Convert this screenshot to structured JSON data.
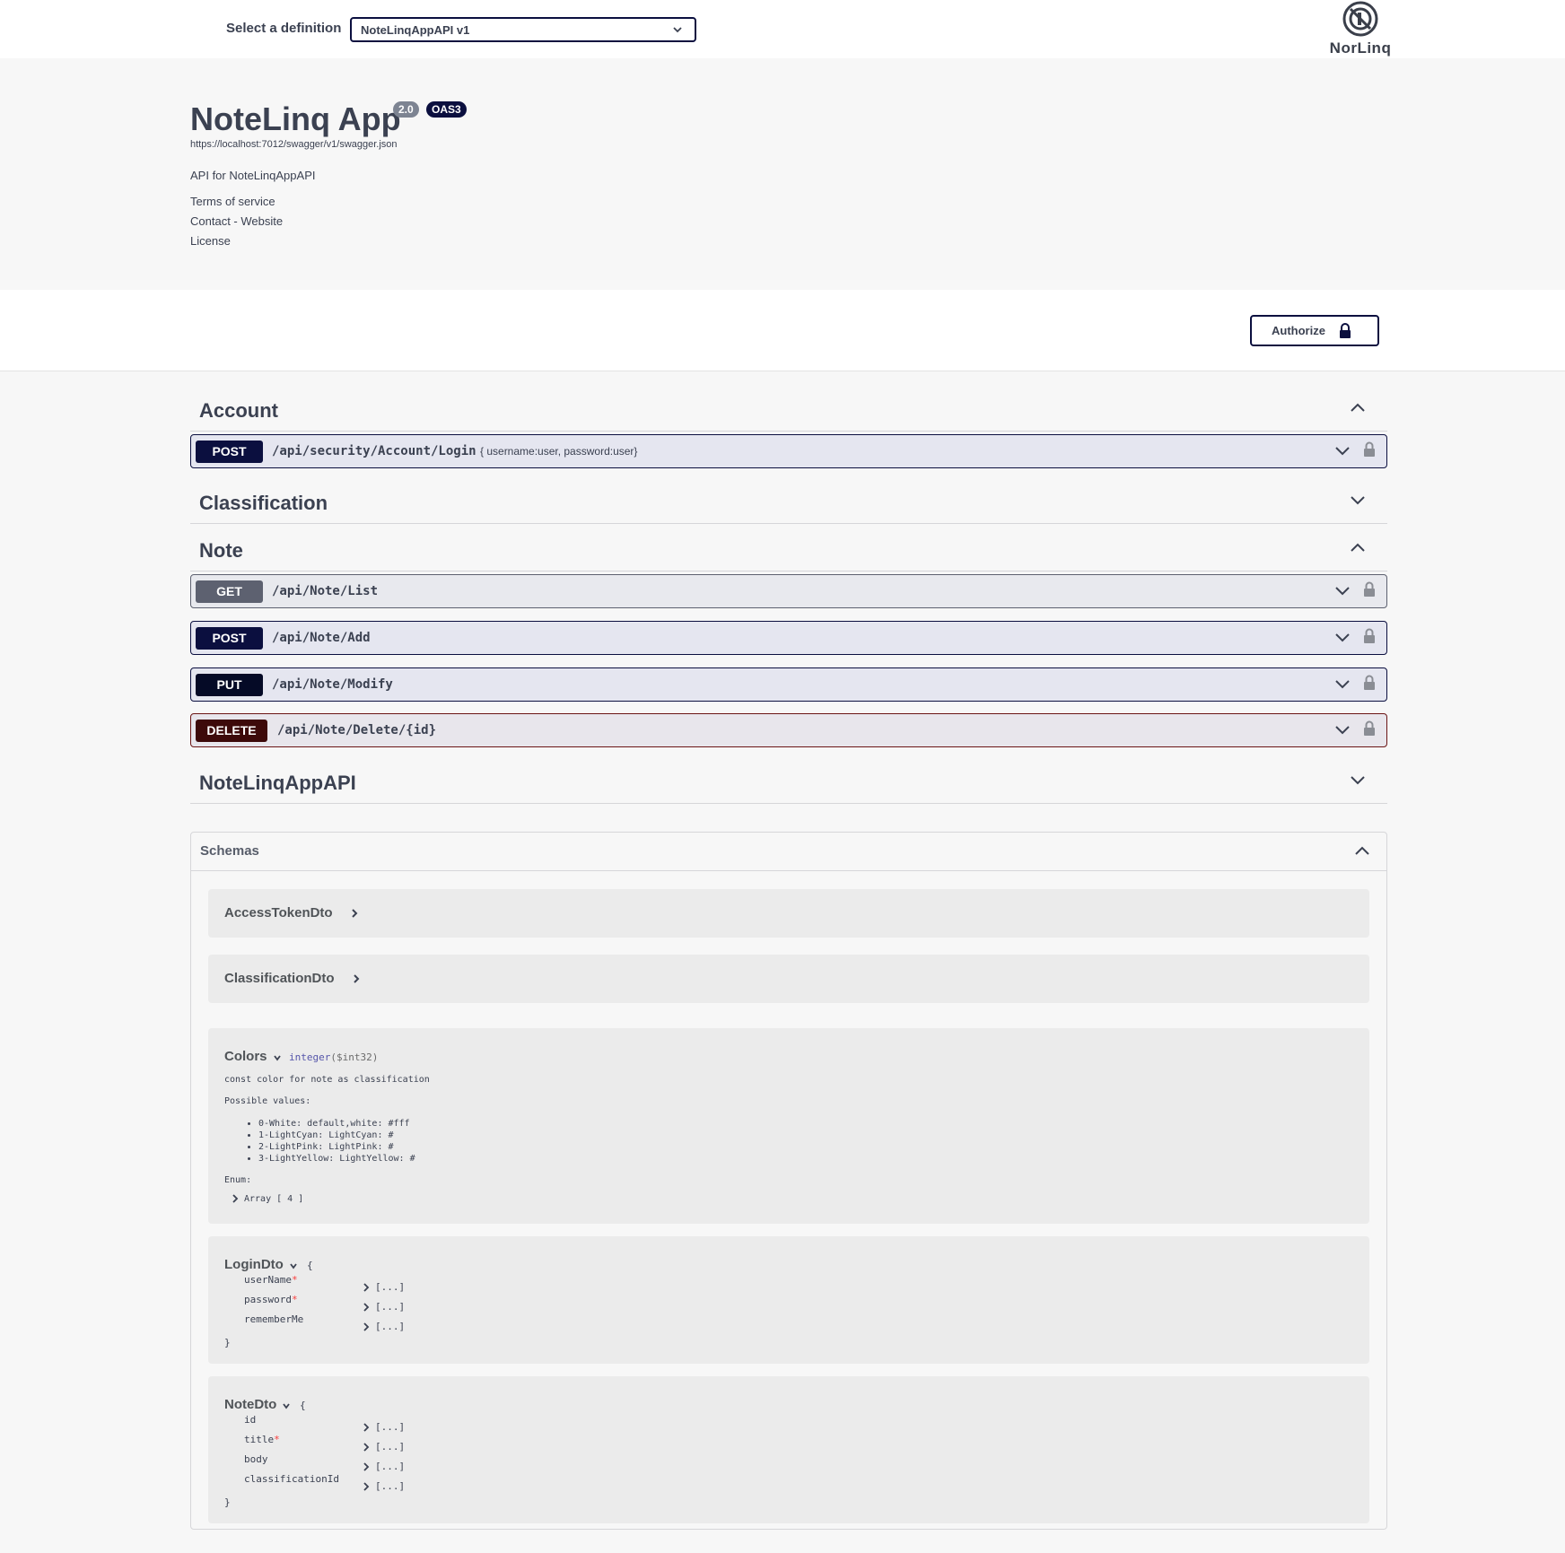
{
  "topbar": {
    "definition_label": "Select a definition",
    "definition_value": "NoteLinqAppAPI v1",
    "logo_text": "NorLinq"
  },
  "info": {
    "title": "NoteLinq App",
    "version": "2.0",
    "oas": "OAS3",
    "spec_url": "https://localhost:7012/swagger/v1/swagger.json",
    "description": "API for NoteLinqAppAPI",
    "links": [
      "Terms of service",
      "Contact - Website",
      "License"
    ]
  },
  "scheme": {
    "authorize_label": "Authorize"
  },
  "tags": {
    "account": "Account",
    "classification": "Classification",
    "note": "Note",
    "api": "NoteLinqAppAPI"
  },
  "operations": {
    "login": {
      "method": "POST",
      "path": "/api/security/Account/Login",
      "summary": "{ username:user, password:user}"
    },
    "list": {
      "method": "GET",
      "path": "/api/Note/List"
    },
    "add": {
      "method": "POST",
      "path": "/api/Note/Add"
    },
    "modify": {
      "method": "PUT",
      "path": "/api/Note/Modify"
    },
    "delete": {
      "method": "DELETE",
      "path": "/api/Note/Delete/{id}"
    }
  },
  "schemas": {
    "title": "Schemas",
    "access_token": "AccessTokenDto",
    "classification": "ClassificationDto",
    "colors": {
      "name": "Colors",
      "type": "integer",
      "format": "($int32)",
      "description": "const color for note as classification",
      "possible_label": "Possible values:",
      "values": [
        "0-White: default,white: #fff",
        "1-LightCyan: LightCyan: #",
        "2-LightPink: LightPink: #",
        "3-LightYellow: LightYellow: #"
      ],
      "enum_label": "Enum:",
      "enum_value": "Array [ 4 ]"
    },
    "login": {
      "name": "LoginDto",
      "open": "{",
      "close": "}",
      "props": [
        "userName",
        "password",
        "rememberMe"
      ],
      "required_mark": "*",
      "collapsed": "[...]"
    },
    "note": {
      "name": "NoteDto",
      "open": "{",
      "close": "}",
      "props": [
        "id",
        "title",
        "body",
        "classificationId"
      ],
      "required_mark": "*",
      "collapsed": "[...]"
    }
  },
  "colors": {
    "primary": "#0b0f3f",
    "get": "#5d6170",
    "delete": "#3d0a0a",
    "text": "#3b4151"
  }
}
